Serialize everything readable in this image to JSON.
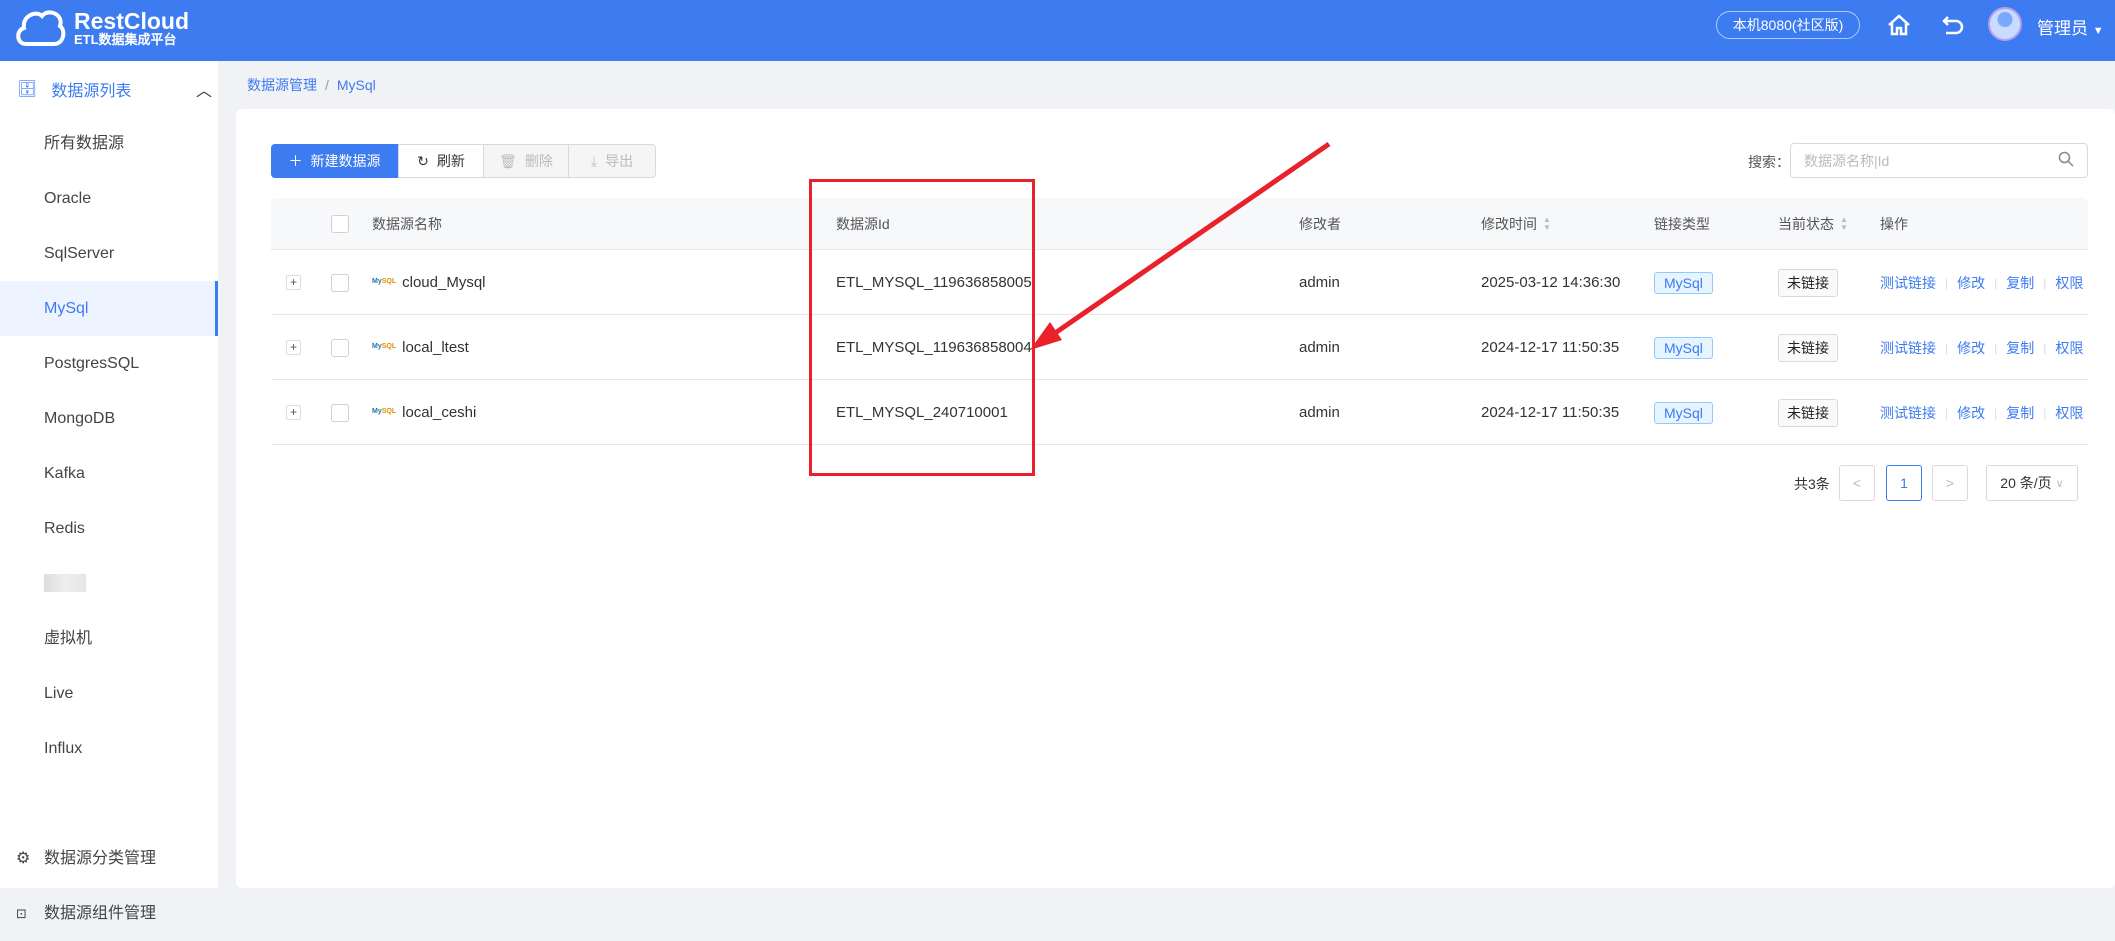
{
  "header": {
    "brand": "RestCloud",
    "subtitle": "ETL数据集成平台",
    "env": "本机8080(社区版)",
    "user": "管理员"
  },
  "sidebar": {
    "group": "数据源列表",
    "items": [
      {
        "label": "所有数据源"
      },
      {
        "label": "Oracle"
      },
      {
        "label": "SqlServer"
      },
      {
        "label": "MySql",
        "active": true
      },
      {
        "label": "PostgresSQL"
      },
      {
        "label": "MongoDB"
      },
      {
        "label": "Kafka"
      },
      {
        "label": "Redis"
      },
      {
        "label": ""
      },
      {
        "label": "虚拟机"
      },
      {
        "label": "Live"
      },
      {
        "label": "Influx"
      }
    ],
    "bottom": [
      {
        "label": "数据源分类管理",
        "icon": "gear-icon"
      },
      {
        "label": "数据源组件管理",
        "icon": "terminal-icon"
      }
    ]
  },
  "breadcrumb": {
    "root": "数据源管理",
    "current": "MySql"
  },
  "toolbar": {
    "new": "新建数据源",
    "refresh": "刷新",
    "delete": "删除",
    "export": "导出",
    "search_label": "搜索：",
    "search_placeholder": "数据源名称|Id"
  },
  "table": {
    "headers": {
      "name": "数据源名称",
      "id": "数据源Id",
      "modifier": "修改者",
      "time": "修改时间",
      "type": "链接类型",
      "status": "当前状态",
      "ops": "操作"
    },
    "rows": [
      {
        "name": "cloud_Mysql",
        "id": "ETL_MYSQL_119636858005",
        "modifier": "admin",
        "time": "2025-03-12 14:36:30",
        "type": "MySql",
        "status": "未链接"
      },
      {
        "name": "local_ltest",
        "id": "ETL_MYSQL_119636858004",
        "modifier": "admin",
        "time": "2024-12-17 11:50:35",
        "type": "MySql",
        "status": "未链接"
      },
      {
        "name": "local_ceshi",
        "id": "ETL_MYSQL_240710001",
        "modifier": "admin",
        "time": "2024-12-17 11:50:35",
        "type": "MySql",
        "status": "未链接"
      }
    ],
    "actions": [
      "测试链接",
      "修改",
      "复制",
      "权限"
    ],
    "logo_text": "MySQL"
  },
  "pagination": {
    "total": "共3条",
    "page": "1",
    "size": "20 条/页"
  },
  "colors": {
    "primary": "#3d7bf0",
    "annotation": "#e8212b"
  }
}
